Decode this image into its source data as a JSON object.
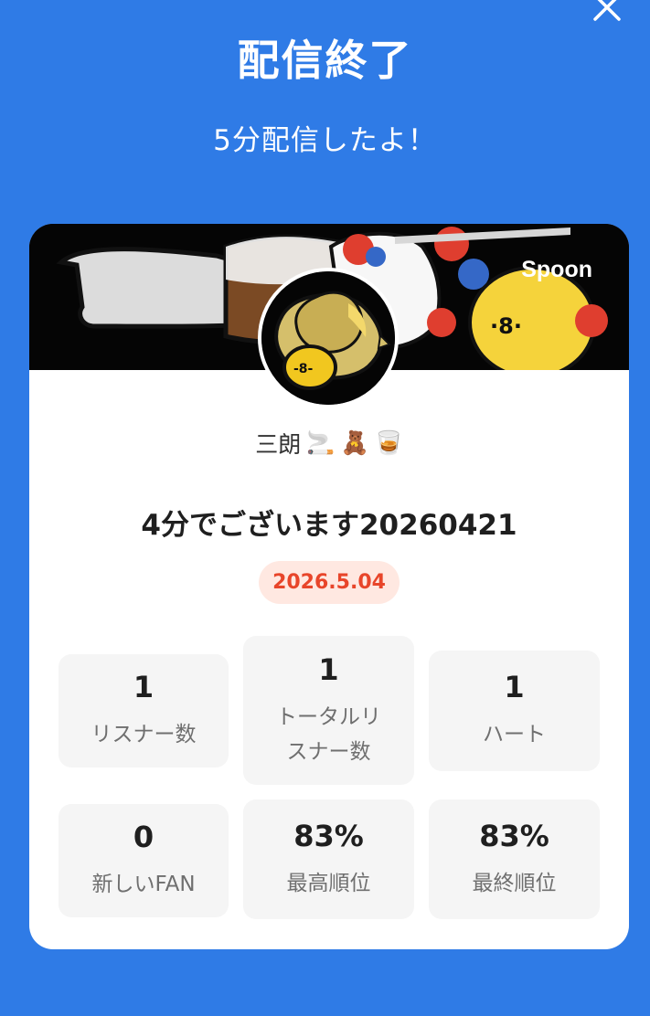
{
  "header": {
    "title": "配信終了",
    "subtitle": "5分配信したよ！"
  },
  "banner": {
    "brand": "Spoon"
  },
  "profile": {
    "username": "三朗",
    "emoji": [
      "🚬",
      "🧸",
      "🥃"
    ]
  },
  "stream": {
    "title": "4分でございます20260421",
    "date": "2026.5.04"
  },
  "stats": [
    {
      "value": "1",
      "label": "リスナー数"
    },
    {
      "value": "1",
      "label": "トータルリスナー数"
    },
    {
      "value": "1",
      "label": "ハート"
    },
    {
      "value": "0",
      "label": "新しいFAN"
    },
    {
      "value": "83%",
      "label": "最高順位"
    },
    {
      "value": "83%",
      "label": "最終順位"
    }
  ],
  "colors": {
    "background": "#2f7be6",
    "card": "#ffffff",
    "badge_bg": "#ffe8e1",
    "badge_text": "#e8452a"
  }
}
